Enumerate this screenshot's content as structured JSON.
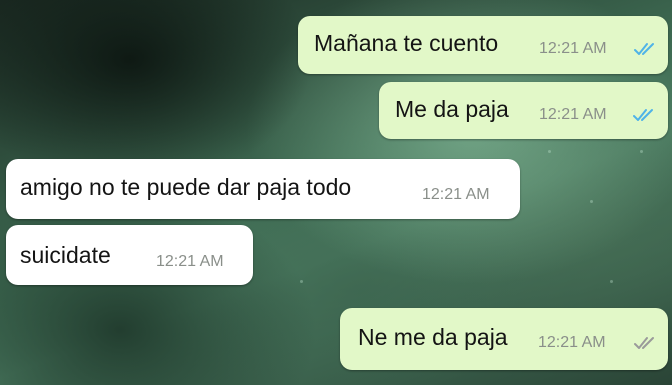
{
  "conversation": {
    "messages": [
      {
        "direction": "outgoing",
        "text": "Mañana te cuento",
        "time": "12:21 AM",
        "status": "read",
        "status_icon": "double-check-blue-icon"
      },
      {
        "direction": "outgoing",
        "text": "Me da paja",
        "time": "12:21 AM",
        "status": "read",
        "status_icon": "double-check-blue-icon"
      },
      {
        "direction": "incoming",
        "text": "amigo no te puede dar paja todo",
        "time": "12:21 AM"
      },
      {
        "direction": "incoming",
        "text": "suicidate",
        "time": "12:21 AM"
      },
      {
        "direction": "outgoing",
        "text": "Ne me da paja",
        "time": "12:21 AM",
        "status": "delivered",
        "status_icon": "double-check-gray-icon"
      }
    ]
  },
  "colors": {
    "outgoing_bubble": "#e2f8c8",
    "incoming_bubble": "#ffffff",
    "read_tick": "#4fb3e8",
    "delivered_tick": "#9a9a9a"
  }
}
